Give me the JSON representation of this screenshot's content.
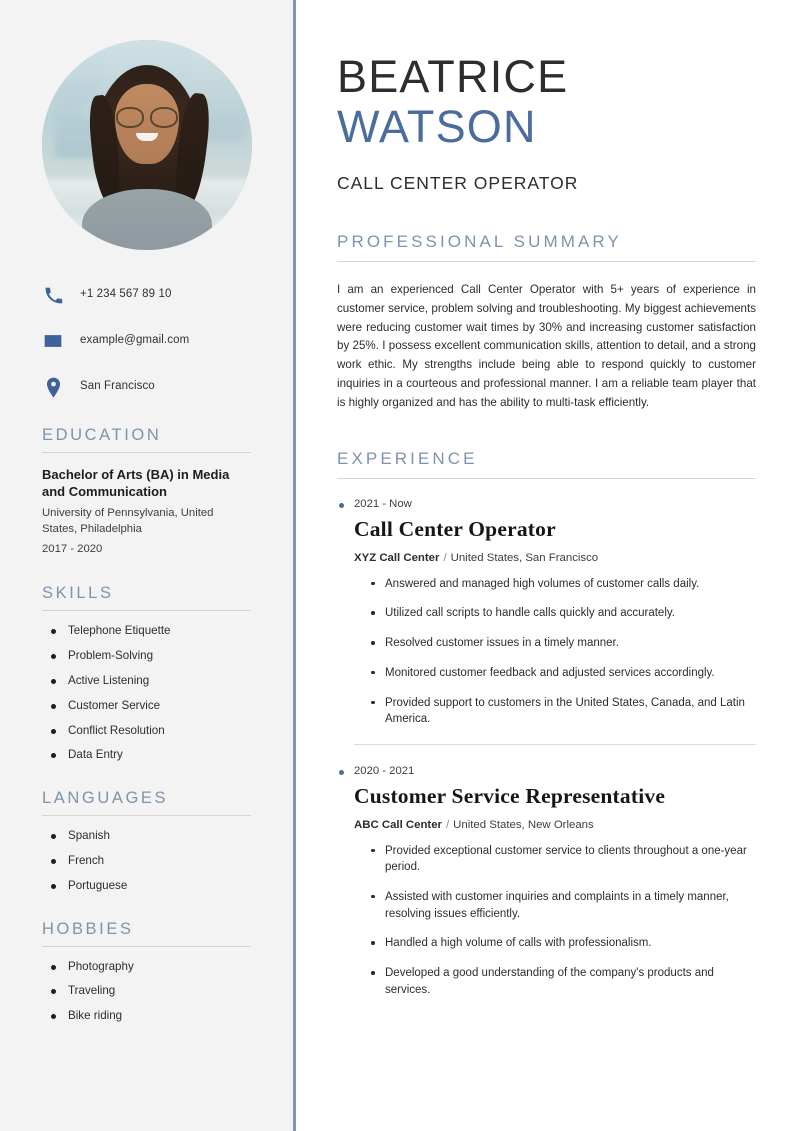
{
  "colors": {
    "accent_blue": "#4a6d9e",
    "heading_blue": "#7e93ad",
    "divider_blue": "#8494b4",
    "sidebar_bg": "#f4f3f3",
    "main_bg": "#ffffff",
    "text_dark": "#2b2d2f"
  },
  "header": {
    "first_name": "BEATRICE",
    "last_name": "WATSON",
    "job_title": "CALL CENTER OPERATOR"
  },
  "sidebar": {
    "photo_alt": "profile-photo",
    "contact": [
      {
        "icon": "phone-icon",
        "value": "+1 234 567 89 10"
      },
      {
        "icon": "envelope-icon",
        "value": "example@gmail.com"
      },
      {
        "icon": "location-pin-icon",
        "value": "San Francisco"
      }
    ],
    "education": {
      "heading": "EDUCATION",
      "degree": "Bachelor of Arts (BA) in Media and Communication",
      "school": "University of Pennsylvania, United States, Philadelphia",
      "dates": "2017 - 2020"
    },
    "skills": {
      "heading": "SKILLS",
      "items": [
        "Telephone Etiquette",
        "Problem-Solving",
        "Active Listening",
        "Customer Service",
        "Conflict Resolution",
        "Data Entry"
      ]
    },
    "languages": {
      "heading": "LANGUAGES",
      "items": [
        "Spanish",
        "French",
        "Portuguese"
      ]
    },
    "hobbies": {
      "heading": "HOBBIES",
      "items": [
        "Photography",
        "Traveling",
        "Bike riding"
      ]
    }
  },
  "main": {
    "summary": {
      "heading": "PROFESSIONAL SUMMARY",
      "text": "I am an experienced Call Center Operator with 5+ years of experience in customer service, problem solving and troubleshooting. My biggest achievements were reducing customer wait times by 30% and increasing customer satisfaction by 25%. I possess excellent communication skills, attention to detail, and a strong work ethic. My strengths include being able to respond quickly to customer inquiries in a courteous and professional manner. I am a reliable team player that is highly organized and has the ability to multi-task efficiently."
    },
    "experience": {
      "heading": "EXPERIENCE",
      "entries": [
        {
          "dates": "2021 - Now",
          "role": "Call Center Operator",
          "company": "XYZ Call Center",
          "separator": "/",
          "location": "United States, San Francisco",
          "bullets": [
            "Answered and managed high volumes of customer calls daily.",
            "Utilized call scripts to handle calls quickly and accurately.",
            "Resolved customer issues in a timely manner.",
            "Monitored customer feedback and adjusted services accordingly.",
            "Provided support to customers in the United States, Canada, and Latin America."
          ]
        },
        {
          "dates": "2020 -  2021",
          "role": "Customer Service Representative",
          "company": "ABC Call Center",
          "separator": "/",
          "location": "United States, New Orleans",
          "bullets": [
            "Provided exceptional customer service to clients throughout a one-year period.",
            "Assisted with customer inquiries and complaints in a timely manner, resolving issues efficiently.",
            "Handled a high volume of calls with professionalism.",
            "Developed a good understanding of the company's products and services."
          ]
        }
      ]
    }
  }
}
